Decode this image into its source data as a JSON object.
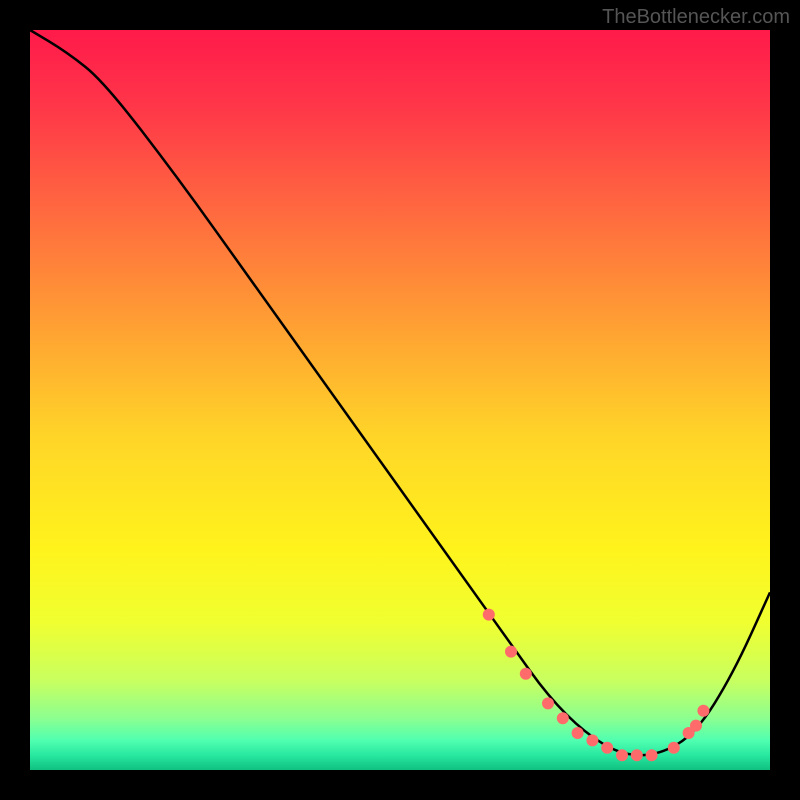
{
  "watermark": "TheBottlenecker.com",
  "chart_data": {
    "type": "line",
    "title": "",
    "xlabel": "",
    "ylabel": "",
    "xlim": [
      0,
      100
    ],
    "ylim": [
      0,
      100
    ],
    "gradient_stops": [
      {
        "offset": 0.0,
        "color": "#ff1a4a"
      },
      {
        "offset": 0.1,
        "color": "#ff3549"
      },
      {
        "offset": 0.25,
        "color": "#ff6b3f"
      },
      {
        "offset": 0.4,
        "color": "#ffa033"
      },
      {
        "offset": 0.55,
        "color": "#ffd528"
      },
      {
        "offset": 0.7,
        "color": "#fff31c"
      },
      {
        "offset": 0.8,
        "color": "#f0ff30"
      },
      {
        "offset": 0.88,
        "color": "#c8ff60"
      },
      {
        "offset": 0.93,
        "color": "#8cff90"
      },
      {
        "offset": 0.96,
        "color": "#50ffb0"
      },
      {
        "offset": 0.98,
        "color": "#28e8a0"
      },
      {
        "offset": 1.0,
        "color": "#10c080"
      }
    ],
    "series": [
      {
        "name": "bottleneck-curve",
        "x": [
          0,
          5,
          10,
          20,
          30,
          40,
          50,
          60,
          65,
          70,
          75,
          80,
          85,
          90,
          95,
          100
        ],
        "y": [
          100,
          97,
          93,
          80,
          66,
          52,
          38,
          24,
          17,
          10,
          5,
          2,
          2,
          5,
          13,
          24
        ]
      }
    ],
    "markers": {
      "name": "highlight-points",
      "color": "#ff6b6b",
      "x": [
        62,
        65,
        67,
        70,
        72,
        74,
        76,
        78,
        80,
        82,
        84,
        87,
        89,
        90,
        91
      ],
      "y": [
        21,
        16,
        13,
        9,
        7,
        5,
        4,
        3,
        2,
        2,
        2,
        3,
        5,
        6,
        8
      ]
    }
  }
}
